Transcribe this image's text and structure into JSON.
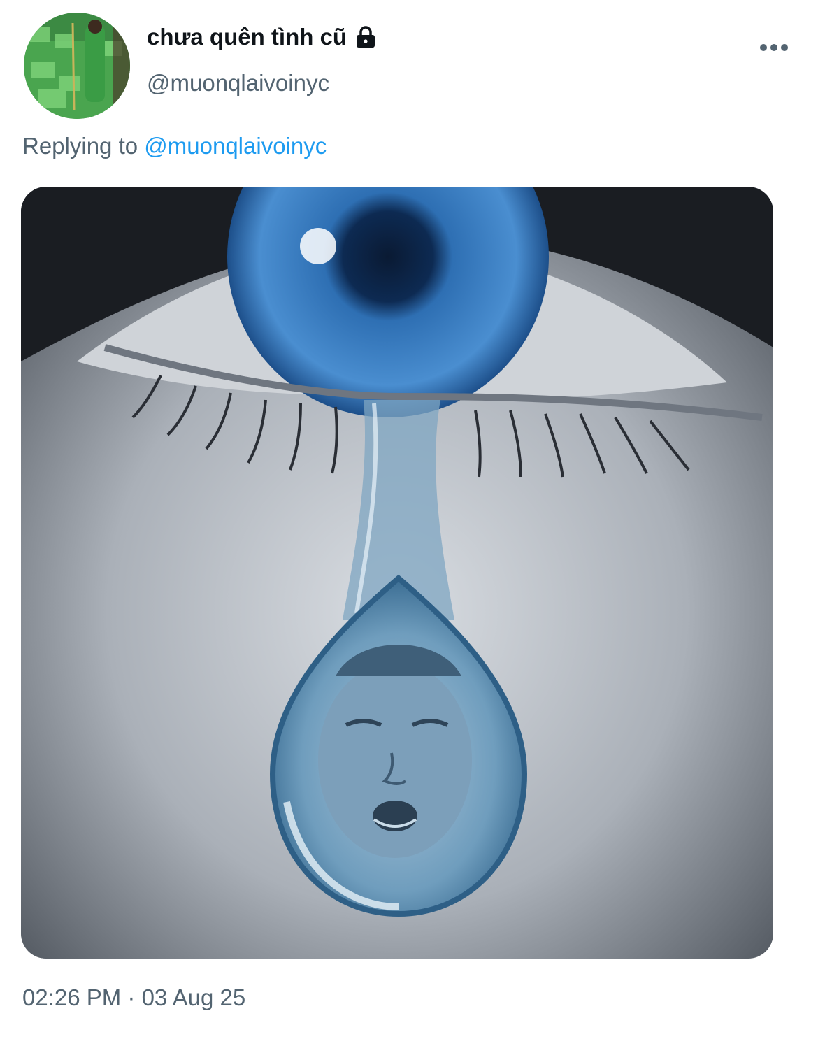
{
  "tweet": {
    "display_name": "chưa quên tình cũ",
    "handle": "@muonqlaivoinyc",
    "replying_prefix": "Replying to",
    "replying_to": "@muonqlaivoinyc",
    "timestamp": "02:26 PM · 03 Aug 25",
    "icons": {
      "protected": "lock-icon",
      "menu": "more-horizontal-icon"
    },
    "colors": {
      "text_primary": "#0f1419",
      "text_secondary": "#536471",
      "link": "#1d9bf0"
    }
  }
}
